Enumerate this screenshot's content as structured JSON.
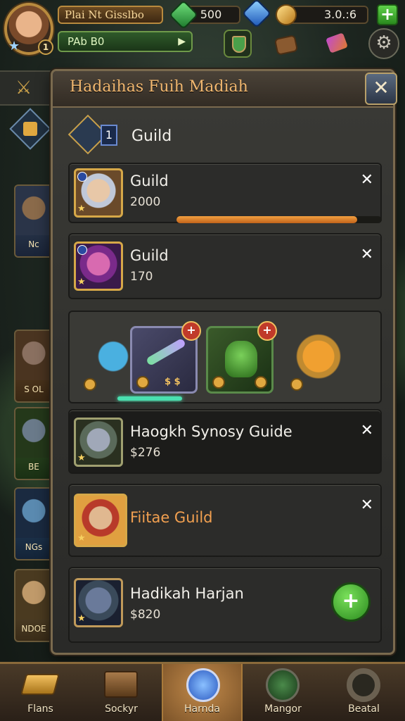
{
  "topbar": {
    "player_name": "Plai Nt Gisslbo",
    "level": "1",
    "xp_label": "PAb B0",
    "resources": [
      {
        "icon": "green-gem-icon",
        "value": "500"
      },
      {
        "icon": "blue-gem-icon",
        "value": ""
      },
      {
        "icon": "gold-shield-icon",
        "value": "3.0.:6"
      }
    ],
    "plus": "+",
    "settings_glyph": "⚙"
  },
  "side": {
    "header_glyph": "⚔",
    "cards": [
      {
        "caption": "Nc"
      },
      {
        "caption": "S OL"
      },
      {
        "caption": "BE"
      },
      {
        "caption": "NGs"
      },
      {
        "caption": "NDOE"
      }
    ]
  },
  "panel": {
    "title": "Hadaihas  Fuih Madiah",
    "close": "✕",
    "guild_header": {
      "badge_number": "1",
      "label": "Guild"
    },
    "rows": [
      {
        "title": "Guild",
        "sub": "2000",
        "close": "✕",
        "progress": 0.88
      },
      {
        "title": "Guild",
        "sub": "170",
        "close": "✕"
      },
      {
        "title": "Haogkh Synosy Guide",
        "sub": "$276",
        "close": "✕"
      },
      {
        "title": "Fiitae Guild",
        "sub": "",
        "close": "✕"
      },
      {
        "title": "Hadikah Harjan",
        "sub": "$820",
        "action": "+"
      }
    ],
    "items": [
      {
        "icon": "blue-pet-icon"
      },
      {
        "icon": "crystal-weapon-icon",
        "badge": "+",
        "price": "$ $"
      },
      {
        "icon": "green-golem-icon",
        "badge": "+"
      },
      {
        "icon": "golden-amulet-icon"
      }
    ]
  },
  "bottom_nav": [
    {
      "label": "Flans",
      "icon": "gold-bar-icon"
    },
    {
      "label": "Sockyr",
      "icon": "chest-icon"
    },
    {
      "label": "Harnda",
      "icon": "blue-emblem-icon"
    },
    {
      "label": "Mangor",
      "icon": "globe-icon"
    },
    {
      "label": "Beatal",
      "icon": "ring-icon"
    }
  ]
}
